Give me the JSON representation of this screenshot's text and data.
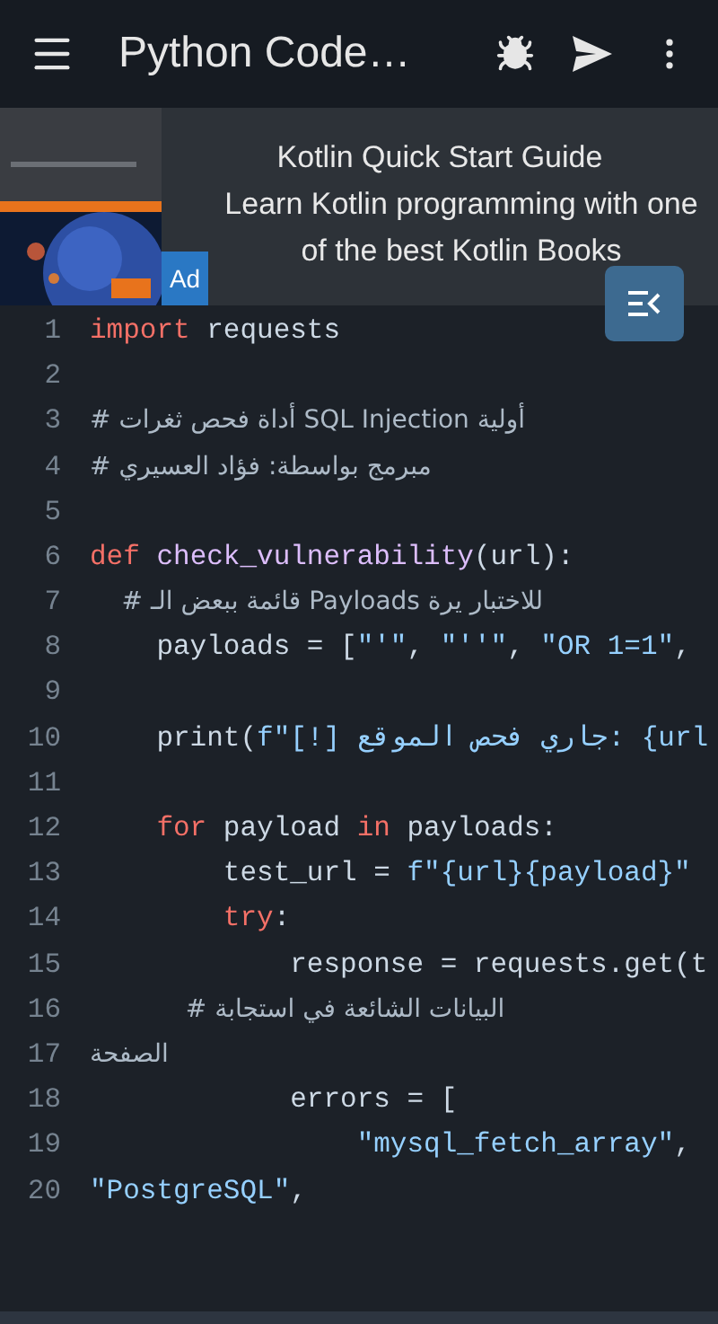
{
  "app_bar": {
    "title": "Python Code…"
  },
  "ad": {
    "badge": "Ad",
    "title": "Kotlin Quick Start Guide",
    "description": "Learn Kotlin programming with one of the best Kotlin Books"
  },
  "code": {
    "lines": [
      {
        "number": "1",
        "tokens": [
          {
            "kind": "keyword",
            "text": "import"
          },
          {
            "kind": "plain",
            "text": " requests"
          }
        ]
      },
      {
        "number": "2"
      },
      {
        "number": "3",
        "tokens": [
          {
            "kind": "comment",
            "text": "# أداة فحص ثغرات SQL Injection أولية"
          }
        ]
      },
      {
        "number": "4",
        "tokens": [
          {
            "kind": "comment",
            "text": "# مبرمج بواسطة: فؤاد العسيري"
          }
        ]
      },
      {
        "number": "5"
      },
      {
        "number": "6",
        "tokens": [
          {
            "kind": "keyword",
            "text": "def "
          },
          {
            "kind": "function",
            "text": "check_vulnerability"
          },
          {
            "kind": "plain",
            "text": "(url):"
          }
        ]
      },
      {
        "number": "7",
        "tokens": [
          {
            "kind": "comment",
            "text": "    # قائمة ببعض الـ Payloads للاختبار يرة"
          }
        ]
      },
      {
        "number": "8",
        "tokens": [
          {
            "kind": "plain",
            "text": "    payloads = ["
          },
          {
            "kind": "string",
            "text": "\"'\""
          },
          {
            "kind": "plain",
            "text": ", "
          },
          {
            "kind": "string",
            "text": "\"''\""
          },
          {
            "kind": "plain",
            "text": ", "
          },
          {
            "kind": "string",
            "text": "\"OR 1=1\""
          },
          {
            "kind": "plain",
            "text": ","
          }
        ]
      },
      {
        "number": "9"
      },
      {
        "number": "10",
        "tokens": [
          {
            "kind": "plain",
            "text": "    print("
          },
          {
            "kind": "string",
            "text": "f\"[!] جاري فحص الموقع: {url"
          }
        ]
      },
      {
        "number": "11"
      },
      {
        "number": "12",
        "tokens": [
          {
            "kind": "keyword",
            "text": "    for"
          },
          {
            "kind": "plain",
            "text": " payload "
          },
          {
            "kind": "keyword",
            "text": "in"
          },
          {
            "kind": "plain",
            "text": " payloads:"
          }
        ]
      },
      {
        "number": "13",
        "tokens": [
          {
            "kind": "plain",
            "text": "        test_url = "
          },
          {
            "kind": "string",
            "text": "f\"{url}{payload}\""
          }
        ]
      },
      {
        "number": "14",
        "tokens": [
          {
            "kind": "keyword",
            "text": "        try"
          },
          {
            "kind": "plain",
            "text": ":"
          }
        ]
      },
      {
        "number": "15",
        "tokens": [
          {
            "kind": "plain",
            "text": "            response = requests.get(t"
          }
        ]
      },
      {
        "number": "16",
        "tokens": [
          {
            "kind": "comment",
            "text": "            # البيانات الشائعة في استجابة"
          }
        ]
      },
      {
        "number": "17",
        "tokens": [
          {
            "kind": "comment",
            "text": "الصفحة"
          }
        ]
      },
      {
        "number": "18",
        "tokens": [
          {
            "kind": "plain",
            "text": "            errors = ["
          }
        ]
      },
      {
        "number": "19",
        "tokens": [
          {
            "kind": "string",
            "text": "                \"mysql_fetch_array\""
          },
          {
            "kind": "plain",
            "text": ","
          }
        ]
      },
      {
        "number": "20",
        "tokens": [
          {
            "kind": "string",
            "text": "\"PostgreSQL\""
          },
          {
            "kind": "plain",
            "text": ","
          }
        ]
      }
    ]
  }
}
